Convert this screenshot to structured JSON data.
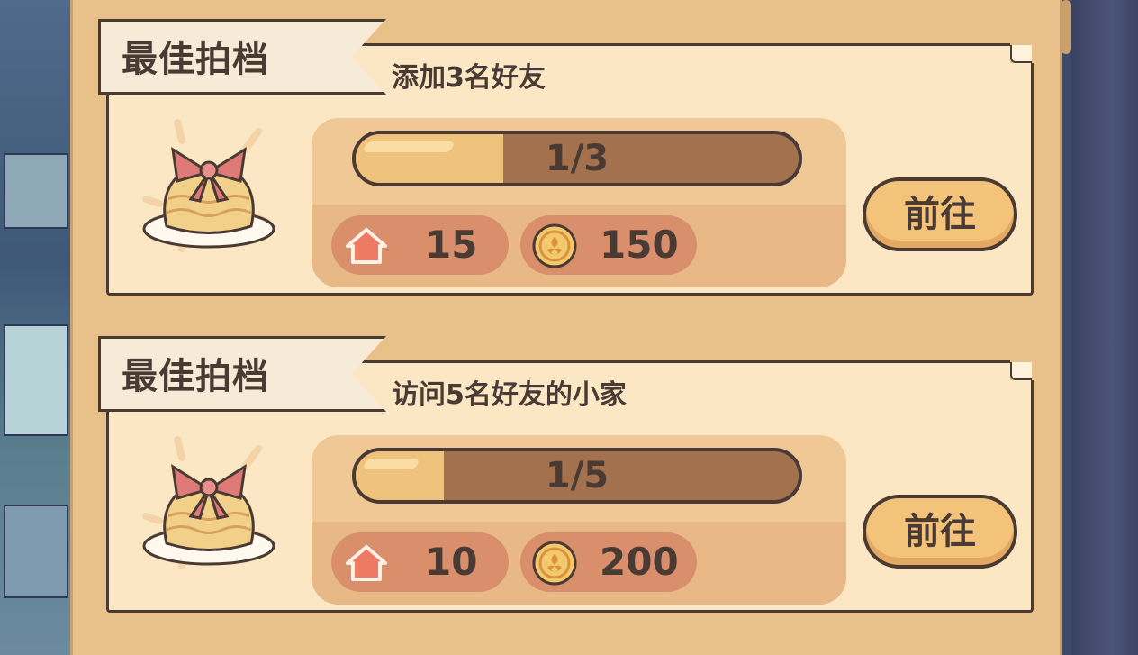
{
  "tasks": [
    {
      "category": "最佳拍档",
      "description": "添加3名好友",
      "progress_text": "1/3",
      "progress_fraction": 0.333,
      "reward_home_value": "15",
      "reward_coin_value": "150",
      "go_label": "前往"
    },
    {
      "category": "最佳拍档",
      "description": "访问5名好友的小家",
      "progress_text": "1/5",
      "progress_fraction": 0.2,
      "reward_home_value": "10",
      "reward_coin_value": "200",
      "go_label": "前往"
    }
  ],
  "icons": {
    "reward_home": "house-icon",
    "reward_coin": "coin-icon",
    "task_image": "cake-with-bow-icon"
  },
  "colors": {
    "panel": "#e8c08a",
    "card": "#fbe7c4",
    "outline": "#4a3a34",
    "progress_fill": "#f0c37c",
    "progress_track": "#a3714e",
    "reward_pill": "#d98f6c",
    "button": "#f3c37a"
  }
}
